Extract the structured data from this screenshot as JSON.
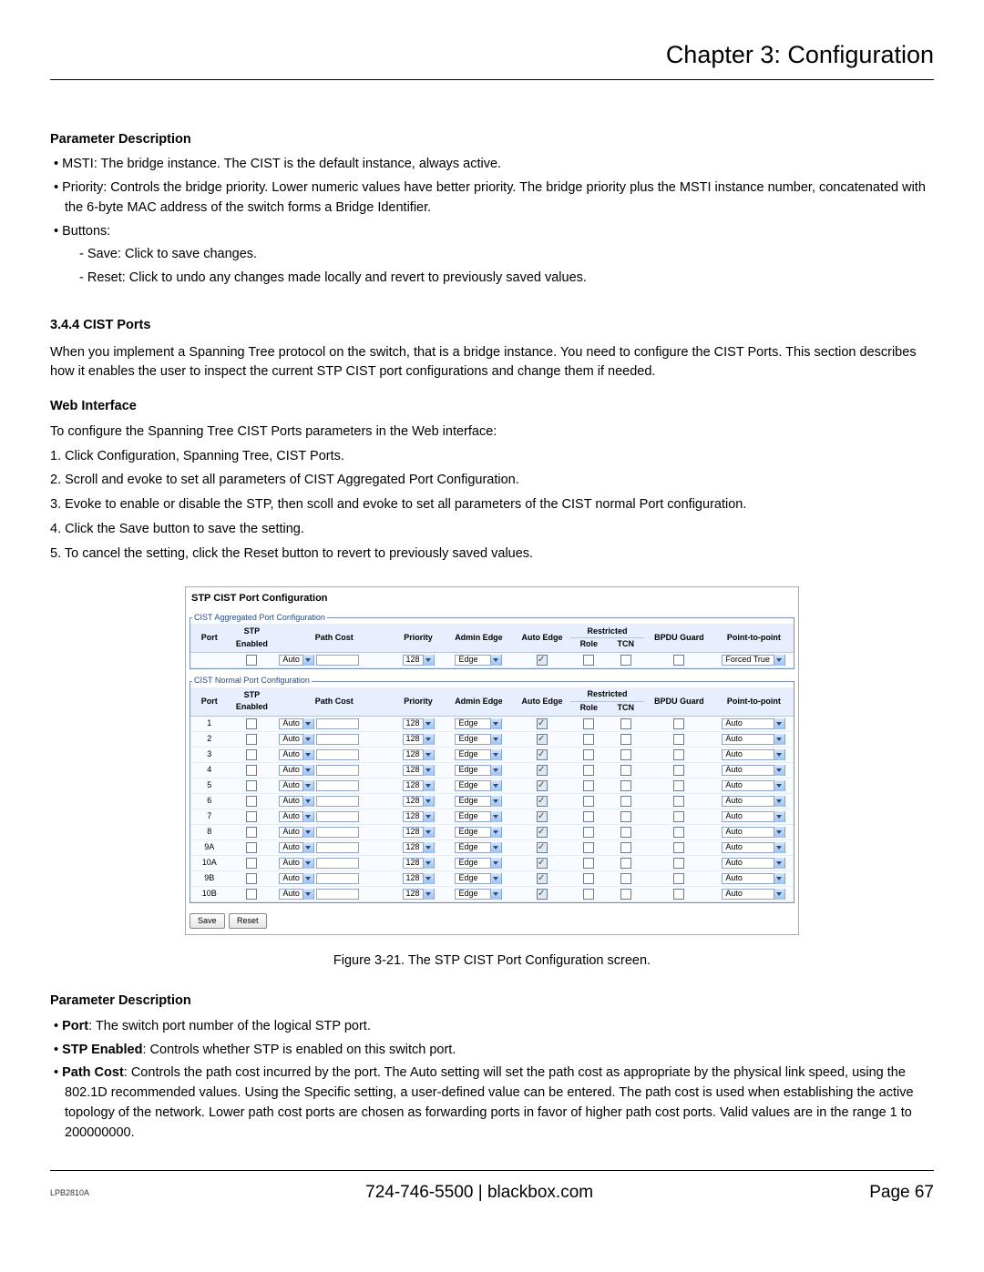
{
  "chapter_title": "Chapter 3: Configuration",
  "param_desc_heading": "Parameter Description",
  "bullets_top": {
    "msti": "MSTI: The bridge instance. The CIST is the default instance, always active.",
    "priority": "Priority: Controls the bridge priority. Lower numeric values have better priority. The bridge priority plus the MSTI instance number, concatenated with the 6-byte MAC address of the switch forms a Bridge Identifier.",
    "buttons_label": "Buttons:",
    "save": "Save: Click to save changes.",
    "reset": "Reset: Click to undo any changes made locally and revert to previously saved values."
  },
  "section_344": {
    "heading": "3.4.4 CIST Ports",
    "intro": "When you implement a Spanning Tree protocol on the switch, that is a bridge instance. You need to configure the CIST Ports. This section describes how it enables the user to inspect the current STP CIST port configurations and change them if needed.",
    "web_heading": "Web Interface",
    "web_intro": "To configure the Spanning Tree CIST Ports parameters in the Web interface:",
    "steps": [
      "1. Click Configuration, Spanning Tree, CIST Ports.",
      "2. Scroll and evoke to set all parameters of CIST Aggregated Port Configuration.",
      "3. Evoke to enable or disable the STP, then scoll and evoke to set all parameters of the CIST normal Port configuration.",
      "4. Click the Save button to save the setting.",
      "5. To cancel the setting, click the Reset button to revert to previously saved values."
    ]
  },
  "figure": {
    "title": "STP CIST Port Configuration",
    "group1_legend": "CIST Aggregated Port Configuration",
    "group2_legend": "CIST Normal Port Configuration",
    "headers": {
      "port": "Port",
      "stp_enabled": "STP Enabled",
      "path_cost": "Path Cost",
      "priority": "Priority",
      "admin_edge": "Admin Edge",
      "auto_edge": "Auto Edge",
      "restricted": "Restricted",
      "role": "Role",
      "tcn": "TCN",
      "bpdu_guard": "BPDU Guard",
      "p2p": "Point-to-point"
    },
    "agg_row": {
      "port": "",
      "path_cost_sel": "Auto",
      "priority": "128",
      "admin_edge": "Edge",
      "p2p": "Forced True"
    },
    "normal_rows": [
      "1",
      "2",
      "3",
      "4",
      "5",
      "6",
      "7",
      "8",
      "9A",
      "10A",
      "9B",
      "10B"
    ],
    "row_defaults": {
      "path_cost_sel": "Auto",
      "priority": "128",
      "admin_edge": "Edge",
      "p2p": "Auto"
    },
    "save_btn": "Save",
    "reset_btn": "Reset",
    "caption": "Figure 3-21. The STP CIST Port Configuration screen."
  },
  "param_desc2": {
    "heading": "Parameter Description",
    "items": [
      {
        "label": "Port",
        "text": ": The switch port number of the logical STP port."
      },
      {
        "label": "STP Enabled",
        "text": ": Controls whether STP is enabled on this switch port."
      },
      {
        "label": "Path Cost",
        "text": ": Controls the path cost incurred by the port. The Auto setting will set the path cost as appropriate by the physical link speed, using the 802.1D recommended values. Using the Specific setting, a user-defined value can be entered. The path cost is used when establishing the active topology of the network. Lower path cost ports are chosen as forwarding ports in favor of higher path cost ports. Valid values are in the range 1 to 200000000."
      }
    ]
  },
  "footer": {
    "model": "LPB2810A",
    "center": "724-746-5500   |   blackbox.com",
    "page": "Page 67"
  }
}
